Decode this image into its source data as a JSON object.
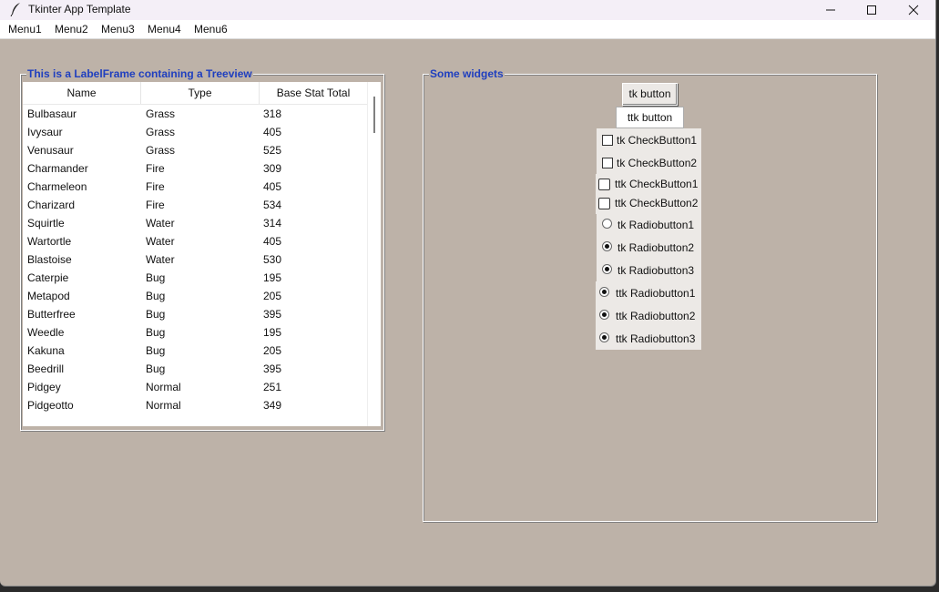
{
  "window": {
    "title": "Tkinter App Template"
  },
  "menubar": [
    "Menu1",
    "Menu2",
    "Menu3",
    "Menu4",
    "Menu6"
  ],
  "left_frame": {
    "title": "This is a LabelFrame containing a Treeview",
    "columns": [
      "Name",
      "Type",
      "Base Stat Total"
    ],
    "rows": [
      [
        "Bulbasaur",
        "Grass",
        "318"
      ],
      [
        "Ivysaur",
        "Grass",
        "405"
      ],
      [
        "Venusaur",
        "Grass",
        "525"
      ],
      [
        "Charmander",
        "Fire",
        "309"
      ],
      [
        "Charmeleon",
        "Fire",
        "405"
      ],
      [
        "Charizard",
        "Fire",
        "534"
      ],
      [
        "Squirtle",
        "Water",
        "314"
      ],
      [
        "Wartortle",
        "Water",
        "405"
      ],
      [
        "Blastoise",
        "Water",
        "530"
      ],
      [
        "Caterpie",
        "Bug",
        "195"
      ],
      [
        "Metapod",
        "Bug",
        "205"
      ],
      [
        "Butterfree",
        "Bug",
        "395"
      ],
      [
        "Weedle",
        "Bug",
        "195"
      ],
      [
        "Kakuna",
        "Bug",
        "205"
      ],
      [
        "Beedrill",
        "Bug",
        "395"
      ],
      [
        "Pidgey",
        "Normal",
        "251"
      ],
      [
        "Pidgeotto",
        "Normal",
        "349"
      ]
    ]
  },
  "right_frame": {
    "title": "Some widgets",
    "tk_button": "tk button",
    "ttk_button": "ttk button",
    "tk_checkbuttons": [
      {
        "label": "tk CheckButton1",
        "checked": false
      },
      {
        "label": "tk CheckButton2",
        "checked": false
      }
    ],
    "ttk_checkbuttons": [
      {
        "label": "ttk CheckButton1",
        "checked": false
      },
      {
        "label": "ttk CheckButton2",
        "checked": false
      }
    ],
    "tk_radiobuttons": [
      {
        "label": "tk Radiobutton1",
        "selected": false
      },
      {
        "label": "tk Radiobutton2",
        "selected": true
      },
      {
        "label": "tk Radiobutton3",
        "selected": true
      }
    ],
    "ttk_radiobuttons": [
      {
        "label": "ttk Radiobutton1",
        "selected": true
      },
      {
        "label": "ttk Radiobutton2",
        "selected": true
      },
      {
        "label": "ttk Radiobutton3",
        "selected": true
      }
    ]
  },
  "colors": {
    "background": "#bdb2a8",
    "frame_title": "#1f3fbf",
    "titlebar": "#f4eff7"
  },
  "icons": {
    "app": "feather-icon",
    "minimize": "minimize-icon",
    "maximize": "maximize-icon",
    "close": "close-icon"
  }
}
